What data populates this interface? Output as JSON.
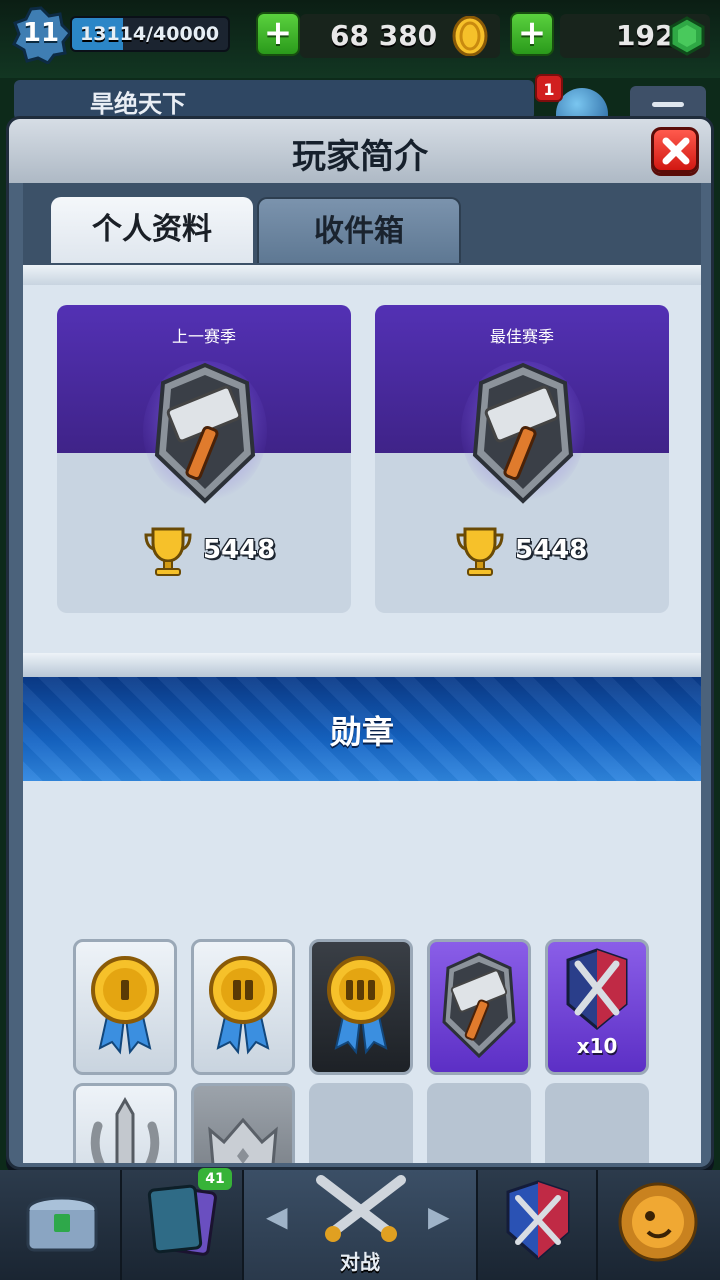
{
  "hud": {
    "level": "11",
    "xp_text": "13114/40000",
    "xp_progress": 0.33,
    "gold": "68 380",
    "gems": "192",
    "clan_name": "旱绝天下",
    "notification_count": "1"
  },
  "modal": {
    "title": "玩家简介",
    "tabs": [
      {
        "label": "个人资料",
        "active": true
      },
      {
        "label": "收件箱",
        "active": false
      }
    ],
    "seasons": [
      {
        "label": "上一赛季",
        "trophies": "5448",
        "arena_icon": "hammer-arena-icon"
      },
      {
        "label": "最佳赛季",
        "trophies": "5448",
        "arena_icon": "hammer-arena-icon"
      }
    ],
    "badges_title": "勋章",
    "badges": [
      {
        "icon": "gold-medal-1-icon",
        "style": "light"
      },
      {
        "icon": "gold-medal-2-icon",
        "style": "light"
      },
      {
        "icon": "gold-medal-3-icon",
        "style": "dark"
      },
      {
        "icon": "hammer-arena-icon",
        "style": "purple"
      },
      {
        "icon": "crossed-swords-shield-icon",
        "style": "purple",
        "count": "x10"
      },
      {
        "icon": "sword-laurel-icon",
        "style": "light"
      },
      {
        "icon": "crown-icon",
        "style": "grey"
      },
      {
        "icon": "",
        "style": "empty"
      },
      {
        "icon": "",
        "style": "empty"
      },
      {
        "icon": "",
        "style": "empty"
      }
    ]
  },
  "bottom_nav": {
    "items": [
      {
        "name": "chest-icon"
      },
      {
        "name": "cards-icon"
      },
      {
        "name": "battle-icon",
        "label": "对战"
      },
      {
        "name": "clan-war-icon"
      },
      {
        "name": "events-icon"
      }
    ],
    "cards_badge": "41"
  },
  "colors": {
    "modal_bg": "#4b627b",
    "season_purple": "#5331b4",
    "banner_blue": "#1564c4",
    "close_red": "#d11812"
  }
}
